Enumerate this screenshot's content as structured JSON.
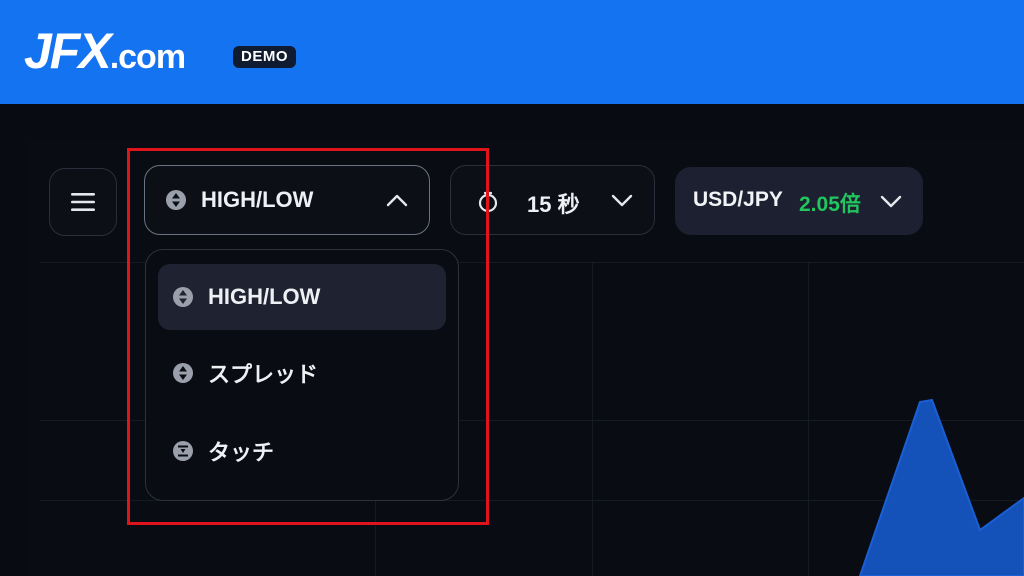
{
  "header": {
    "logo_main": "JFX",
    "logo_suffix": ".com",
    "badge": "DEMO"
  },
  "toolbar": {
    "menu_icon": "hamburger-icon",
    "trade_type": {
      "icon": "diamond-arrows-icon",
      "selected": "HIGH/LOW",
      "state_icon": "chevron-up-icon"
    },
    "duration": {
      "icon": "timer-icon",
      "value": "15 秒",
      "state_icon": "chevron-down-icon"
    },
    "pair": {
      "symbol": "USD/JPY",
      "multiplier": "2.05倍",
      "multiplier_color": "#22c55e",
      "state_icon": "chevron-down-icon"
    }
  },
  "dropdown": {
    "items": [
      {
        "label": "HIGH/LOW",
        "icon": "diamond-arrows-icon",
        "selected": true
      },
      {
        "label": "スプレッド",
        "icon": "diamond-arrows-icon",
        "selected": false
      },
      {
        "label": "タッチ",
        "icon": "touch-icon",
        "selected": false
      }
    ]
  },
  "colors": {
    "brand_blue": "#1473f0",
    "background": "#090b12",
    "highlight": "#e0151b",
    "chart_fill": "#1451b8"
  }
}
